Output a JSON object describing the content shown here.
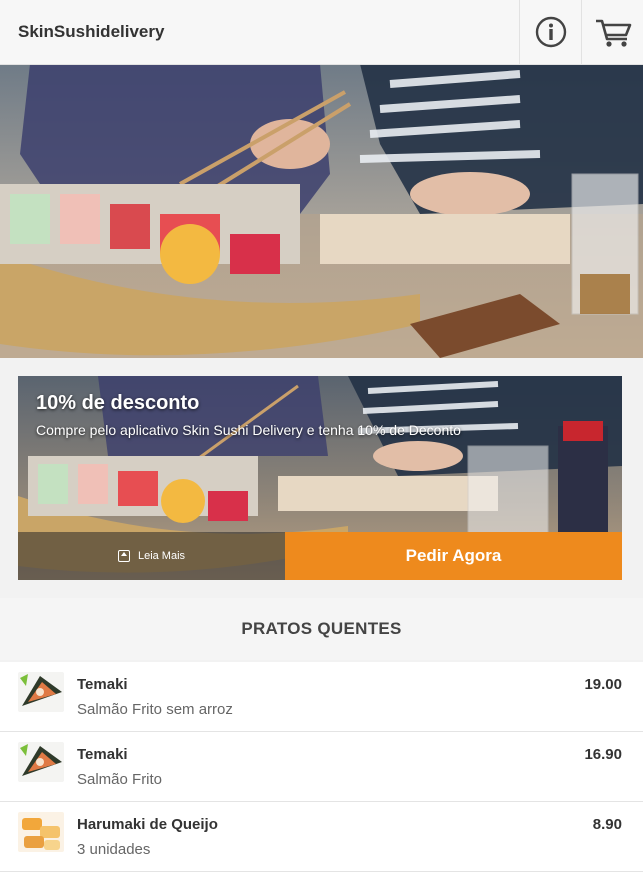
{
  "header": {
    "title": "SkinSushidelivery",
    "info_icon": "info-circle-icon",
    "cart_icon": "shopping-cart-icon"
  },
  "promo": {
    "title": "10% de desconto",
    "subtitle": "Compre pelo aplicativo Skin Sushi Delivery e tenha 10% de Deconto",
    "read_more": "Leia Mais",
    "order_now": "Pedir Agora",
    "accent": "#ee8a1d"
  },
  "section": {
    "title": "PRATOS QUENTES"
  },
  "items": [
    {
      "name": "Temaki",
      "desc": "Salmão Frito sem arroz",
      "price": "19.00"
    },
    {
      "name": "Temaki",
      "desc": "Salmão Frito",
      "price": "16.90"
    },
    {
      "name": "Harumaki de Queijo",
      "desc": "3 unidades",
      "price": "8.90"
    }
  ]
}
